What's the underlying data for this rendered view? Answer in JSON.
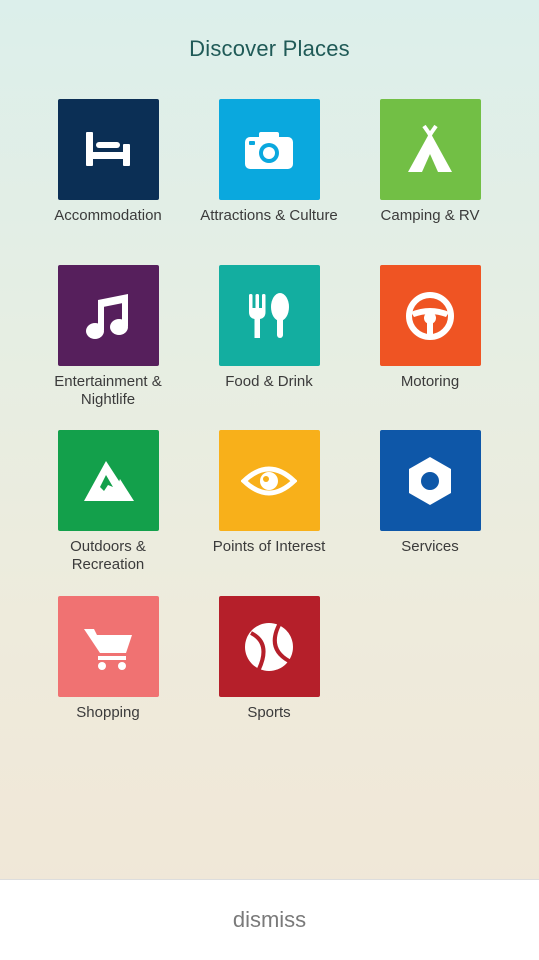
{
  "header": {
    "title": "Discover Places"
  },
  "categories": [
    {
      "label": "Accommodation",
      "icon": "bed-icon",
      "color": "#0b2f55"
    },
    {
      "label": "Attractions & Culture",
      "icon": "camera-icon",
      "color": "#0aa8de"
    },
    {
      "label": "Camping & RV",
      "icon": "tent-icon",
      "color": "#72bf45"
    },
    {
      "label": "Entertainment & Nightlife",
      "icon": "music-note-icon",
      "color": "#561f5c"
    },
    {
      "label": "Food & Drink",
      "icon": "fork-spoon-icon",
      "color": "#13aea0"
    },
    {
      "label": "Motoring",
      "icon": "steering-wheel-icon",
      "color": "#ef5423"
    },
    {
      "label": "Outdoors & Recreation",
      "icon": "mountain-icon",
      "color": "#13a04b"
    },
    {
      "label": "Points of Interest",
      "icon": "eye-icon",
      "color": "#f8b01a"
    },
    {
      "label": "Services",
      "icon": "hex-nut-icon",
      "color": "#0e57a8"
    },
    {
      "label": "Shopping",
      "icon": "shopping-cart-icon",
      "color": "#f07272"
    },
    {
      "label": "Sports",
      "icon": "ball-icon",
      "color": "#b51f2a"
    }
  ],
  "footer": {
    "dismiss_label": "dismiss"
  }
}
